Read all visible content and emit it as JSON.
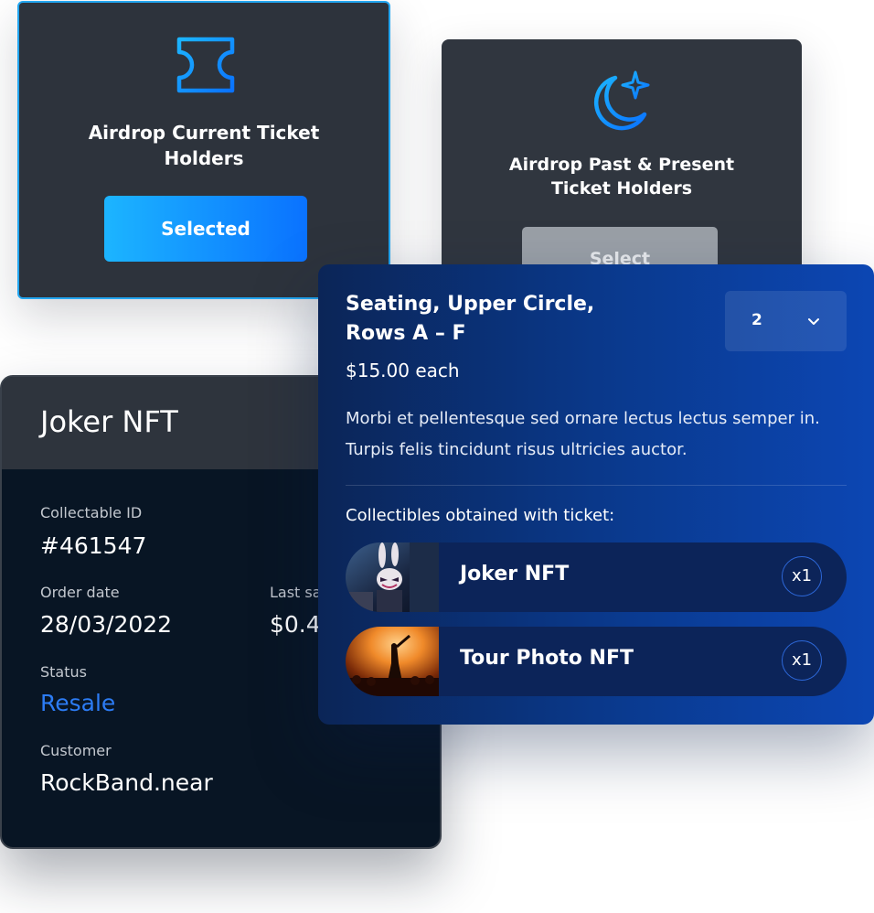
{
  "airdrop_current": {
    "icon": "ticket-icon",
    "title": "Airdrop Current Ticket Holders",
    "button_label": "Selected"
  },
  "airdrop_past": {
    "icon": "moon-star-icon",
    "title": "Airdrop Past & Present Ticket Holders",
    "button_label": "Select"
  },
  "joker_card": {
    "title": "Joker NFT",
    "collectable_id_label": "Collectable ID",
    "collectable_id": "#461547",
    "order_date_label": "Order date",
    "order_date": "28/03/2022",
    "last_sale_label": "Last sa",
    "last_sale_value": "$0.4",
    "status_label": "Status",
    "status_value": "Resale",
    "customer_label": "Customer",
    "customer_value": "RockBand.near"
  },
  "seat_card": {
    "title": "Seating, Upper Circle, Rows A – F",
    "quantity": "2",
    "price": "$15.00 each",
    "description": "Morbi et pellentesque sed ornare lectus lectus semper in. Turpis felis tincidunt risus ultricies auctor.",
    "collectibles_label": "Collectibles obtained with ticket:",
    "collectibles": [
      {
        "name": "Joker NFT",
        "qty": "x1"
      },
      {
        "name": "Tour Photo NFT",
        "qty": "x1"
      }
    ]
  },
  "colors": {
    "accent_blue": "#0a72ff",
    "accent_cyan": "#1cb5ff",
    "status_link": "#2c7cf5",
    "card_dark": "#2d333c"
  }
}
